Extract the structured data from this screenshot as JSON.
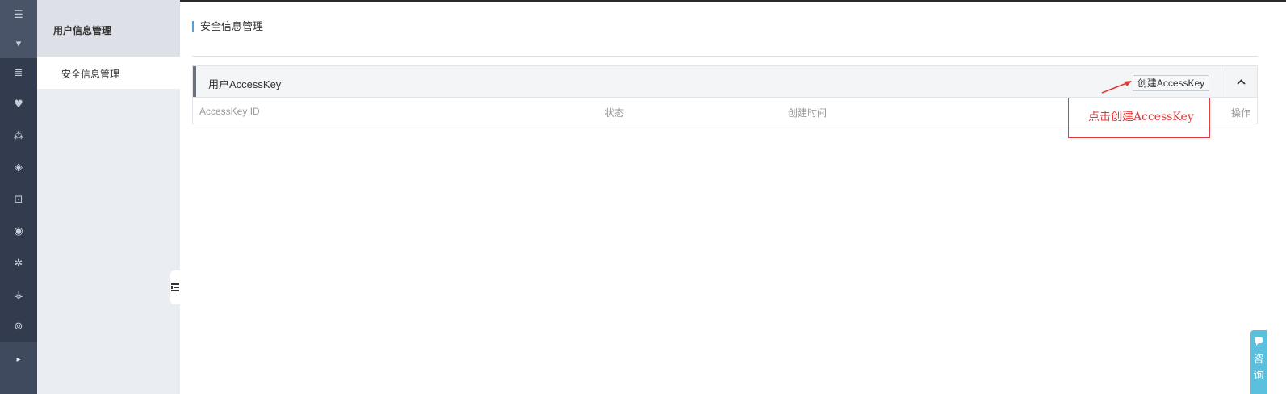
{
  "icon_rail": {
    "menu_icon_glyph": "☰",
    "items": [
      {
        "icon": "caret-down-icon",
        "glyph": "▾"
      },
      {
        "icon": "database-icon",
        "glyph": "≣"
      },
      {
        "icon": "cloud-shield-icon",
        "glyph": "♥"
      },
      {
        "icon": "network-icon",
        "glyph": "⁂"
      },
      {
        "icon": "box-icon",
        "glyph": "◈"
      },
      {
        "icon": "chip-icon",
        "glyph": "⊡"
      },
      {
        "icon": "eye-icon",
        "glyph": "◉"
      },
      {
        "icon": "hub-icon",
        "glyph": "✲"
      },
      {
        "icon": "org-chart-icon",
        "glyph": "⚶"
      },
      {
        "icon": "cloud-icon",
        "glyph": "⊚"
      }
    ],
    "expand_icon_glyph": "▸"
  },
  "subnav": {
    "title": "用户信息管理",
    "items": [
      {
        "label": "安全信息管理",
        "active": true
      }
    ]
  },
  "main": {
    "page_title": "安全信息管理",
    "panel": {
      "title": "用户AccessKey",
      "create_button": "创建AccessKey",
      "columns": [
        "AccessKey ID",
        "状态",
        "创建时间",
        "操作"
      ]
    }
  },
  "annotation": {
    "text": "点击创建AccessKey"
  },
  "consult": {
    "label_1": "咨",
    "label_2": "询"
  },
  "colors": {
    "rail_bg": "#333c4f",
    "accent_blue": "#57a0d8",
    "annotation_red": "#e03a3a",
    "consult_bg": "#5bc0de"
  }
}
